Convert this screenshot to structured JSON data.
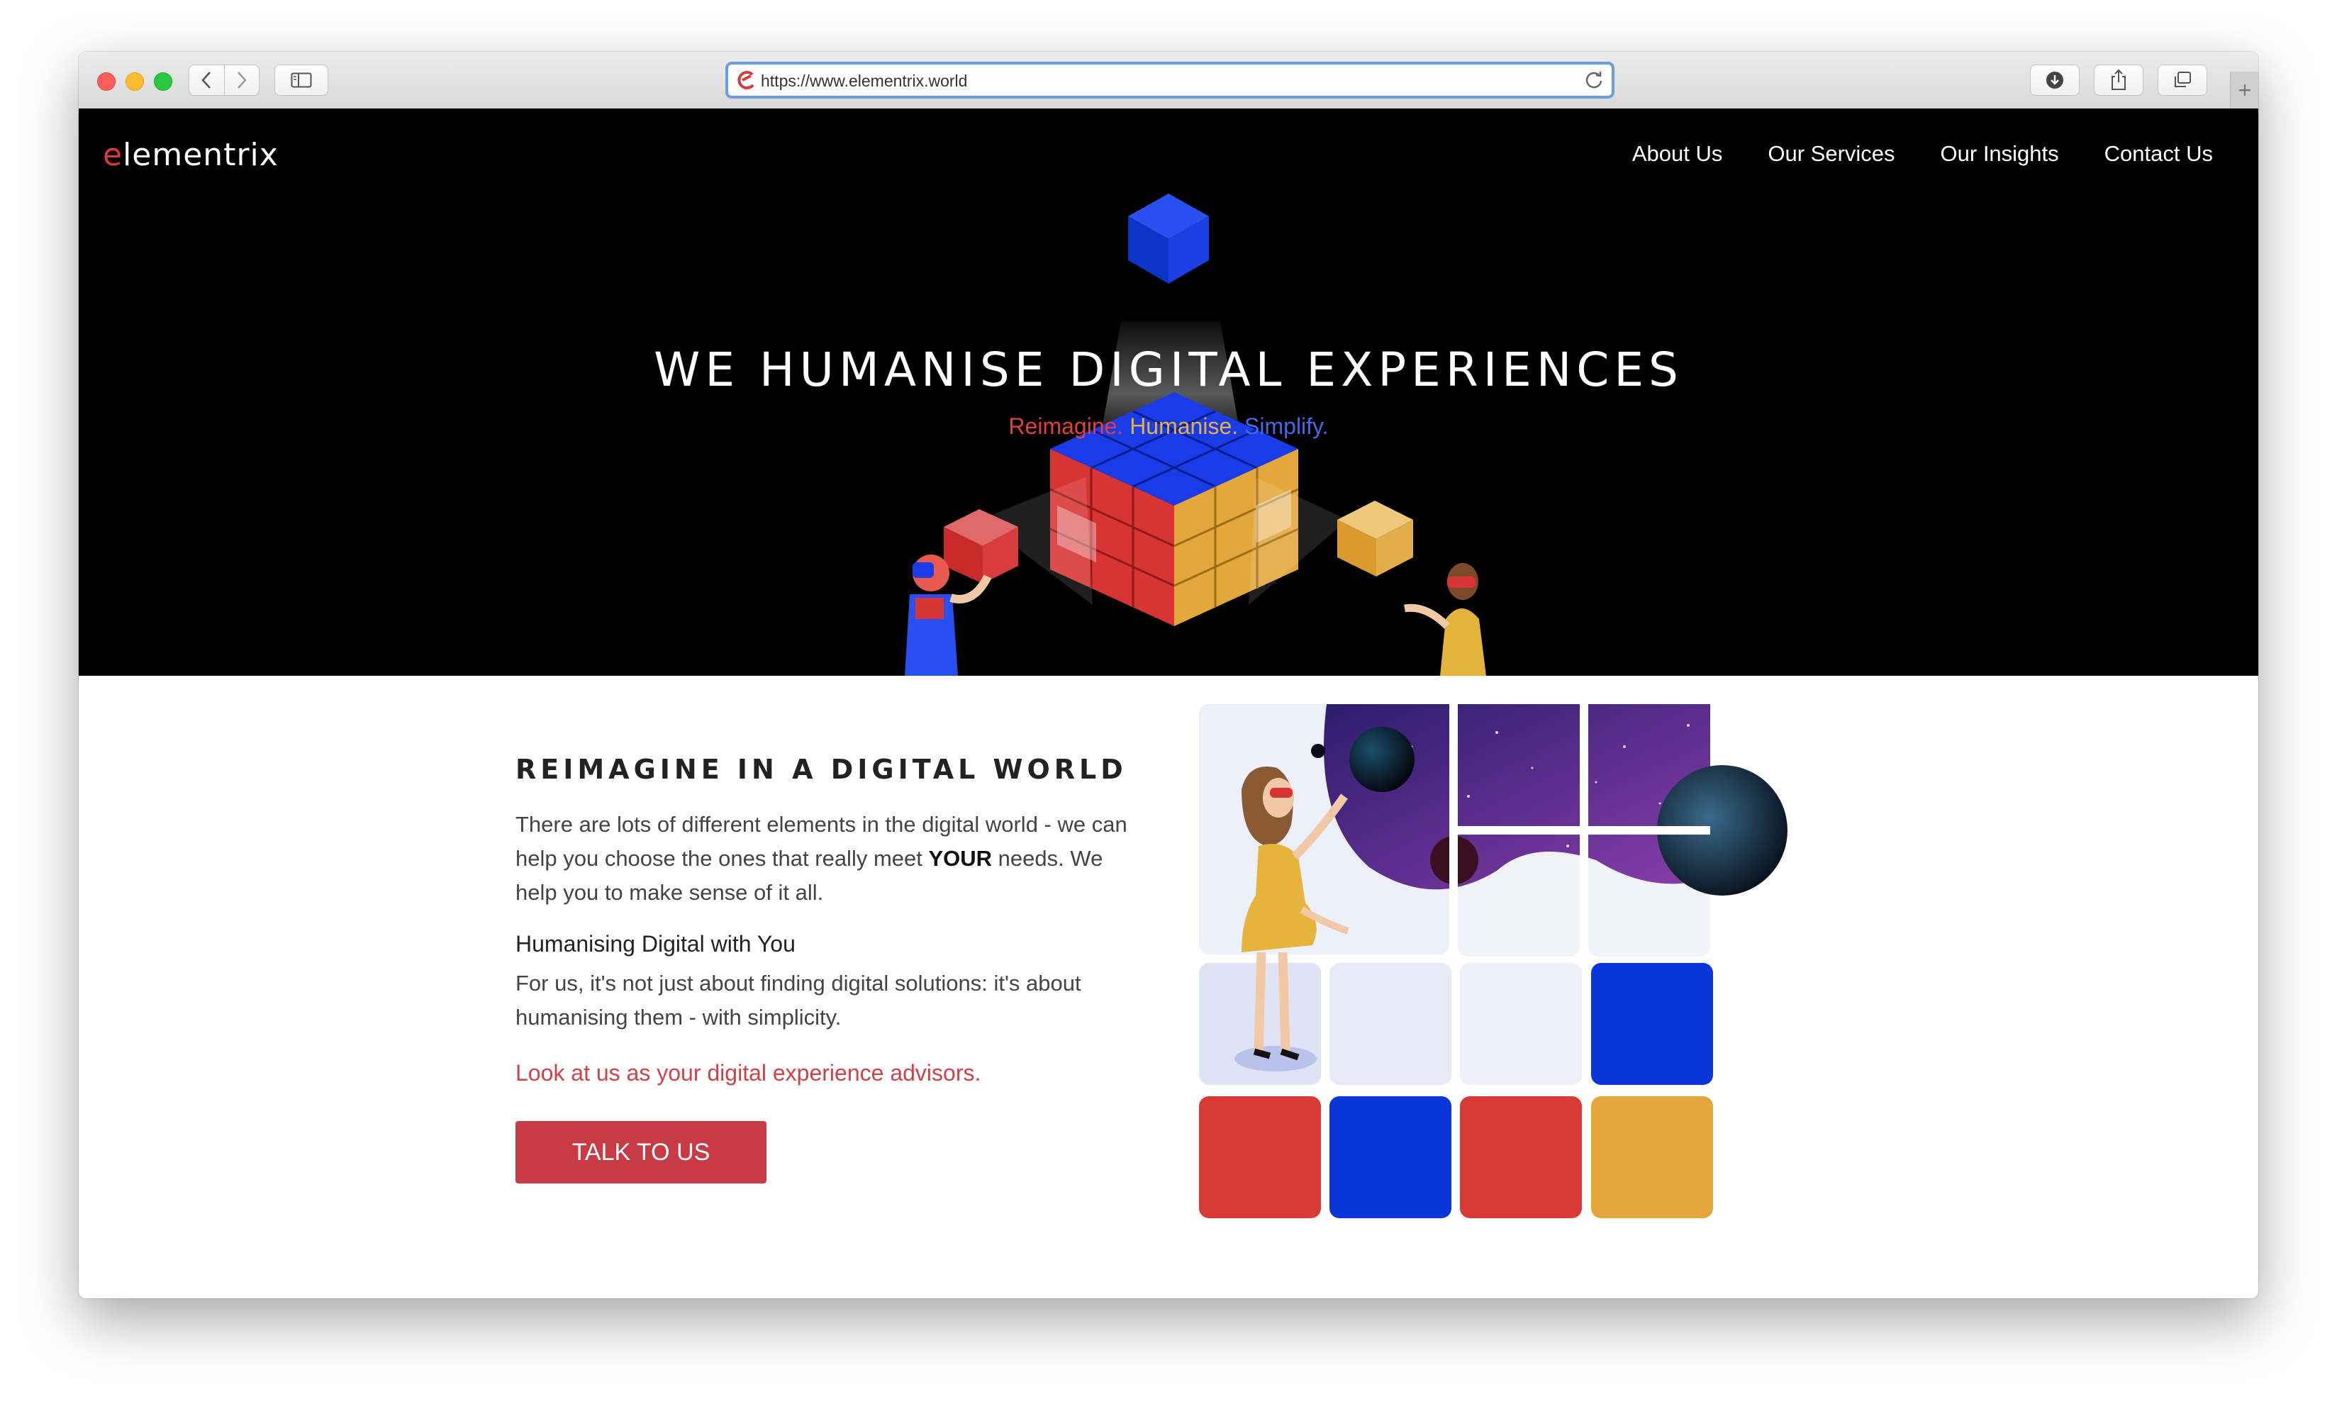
{
  "browser": {
    "url": "https://www.elementrix.world",
    "new_tab_symbol": "+"
  },
  "header": {
    "logo_first": "e",
    "logo_rest": "lementrix",
    "nav": [
      "About Us",
      "Our Services",
      "Our Insights",
      "Contact Us"
    ]
  },
  "hero": {
    "title": "WE HUMANISE DIGITAL EXPERIENCES",
    "tagline": {
      "reimagine": "Reimagine.",
      "humanise": "Humanise.",
      "simplify": "Simplify."
    }
  },
  "section": {
    "title": "REIMAGINE IN A DIGITAL WORLD",
    "p1_start": "There are lots of different elements in the digital world - we can help you choose the ones that really meet ",
    "p1_bold": "YOUR",
    "p1_end": " needs. We help you to make sense of it all.",
    "subheading": "Humanising Digital with You",
    "p2": "For us, it's not just about finding digital solutions: it's about humanising them - with simplicity.",
    "advisor_line": "Look at us as your digital experience advisors.",
    "cta_label": "TALK TO US"
  },
  "colors": {
    "brand_red": "#d63a3a",
    "cta_red": "#c83a44",
    "cube_blue": "#0a3bd9",
    "cube_yellow": "#e3a73c",
    "hero_bg": "#000000"
  },
  "icons": [
    "back-icon",
    "forward-icon",
    "sidebar-icon",
    "site-logo-icon",
    "reload-icon",
    "download-icon",
    "share-icon",
    "tabs-icon"
  ]
}
